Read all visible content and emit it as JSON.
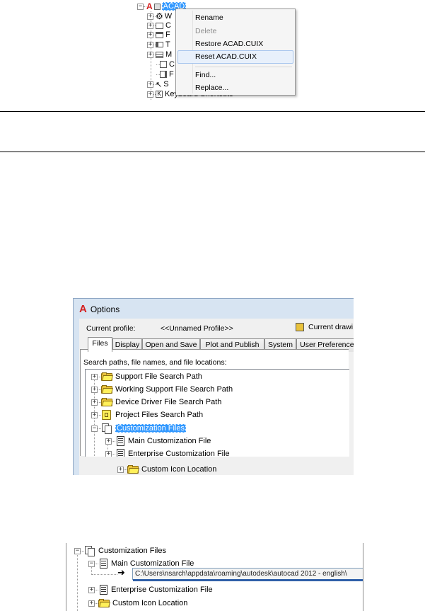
{
  "context_tree": {
    "root_label": "ACAD",
    "partial_items": [
      "W",
      "C",
      "F",
      "T",
      "M",
      "C",
      "F",
      "S"
    ],
    "bottom_item": "Keyboard Shortcuts"
  },
  "context_menu": {
    "items": [
      {
        "label": "Rename",
        "state": "normal"
      },
      {
        "label": "Delete",
        "state": "disabled"
      },
      {
        "label": "Restore ACAD.CUIX",
        "state": "normal"
      },
      {
        "label": "Reset ACAD.CUIX",
        "state": "highlighted"
      },
      {
        "label": "Find...",
        "state": "normal"
      },
      {
        "label": "Replace...",
        "state": "normal"
      }
    ]
  },
  "options_dialog": {
    "title": "Options",
    "current_profile_label": "Current profile:",
    "current_profile_value": "<<Unnamed Profile>>",
    "current_drawing_label": "Current drawi",
    "tabs": [
      "Files",
      "Display",
      "Open and Save",
      "Plot and Publish",
      "System",
      "User Preferences"
    ],
    "active_tab": "Files",
    "tree_caption": "Search paths, file names, and file locations:",
    "tree_items": [
      {
        "label": "Support File Search Path",
        "icon": "folder-stack-icon"
      },
      {
        "label": "Working Support File Search Path",
        "icon": "folder-stack-icon"
      },
      {
        "label": "Device Driver File Search Path",
        "icon": "folder-stack-icon"
      },
      {
        "label": "Project Files Search Path",
        "icon": "project-book-icon"
      },
      {
        "label": "Customization Files",
        "icon": "pages-icon",
        "selected": true
      },
      {
        "label": "Main Customization File",
        "icon": "cui-doc-icon"
      },
      {
        "label": "Enterprise Customization File",
        "icon": "cui-doc-icon"
      },
      {
        "label": "Custom Icon Location",
        "icon": "folder-stack-icon"
      }
    ]
  },
  "expanded_tree": {
    "root_label": "Customization Files",
    "main_label": "Main Customization File",
    "path_value": "C:\\Users\\nsarch\\appdata\\roaming\\autodesk\\autocad 2012 - english\\",
    "enterprise_label": "Enterprise Customization File",
    "icon_location_label": "Custom Icon Location"
  },
  "colors": {
    "selection": "#3399ff",
    "menu_highlight": "#e8f0fb",
    "dialog_frame": "#d7e4f2",
    "folder_yellow": "#fff05a",
    "autocad_red": "#d42020"
  }
}
